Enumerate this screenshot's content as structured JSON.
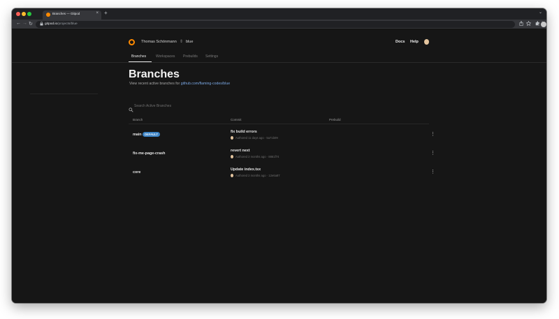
{
  "browser": {
    "tab_title": "Branches — Gitpod",
    "tab_close": "×",
    "new_tab": "+",
    "tabstrip_menu": "⌄",
    "url_host": "gitpod.io",
    "url_path": "/projects/blue",
    "nav": {
      "back": "←",
      "forward": "→",
      "reload": "↻"
    },
    "icons": {
      "lock": "lock-icon",
      "share": "share-icon",
      "star": "star-icon",
      "extensions": "puzzle-icon",
      "menu": "kebab-menu-icon"
    }
  },
  "header": {
    "owner": "Thomas Schönmann",
    "owner_switcher": "⇕",
    "project": "blue",
    "docs": "Docs",
    "help": "Help"
  },
  "subnav": {
    "tabs": [
      {
        "label": "Branches",
        "active": true
      },
      {
        "label": "Workspaces",
        "active": false
      },
      {
        "label": "Prebuilds",
        "active": false
      },
      {
        "label": "Settings",
        "active": false
      }
    ]
  },
  "main": {
    "title": "Branches",
    "subtitle_prefix": "View recent active branches for ",
    "subtitle_repo": "github.com/flaming-codes/blue",
    "search_placeholder": "Search Active Branches"
  },
  "table": {
    "headers": {
      "branch": "Branch",
      "commit": "Commit",
      "prebuild": "Prebuild"
    },
    "rows": [
      {
        "branch": "main",
        "badge": "DEFAULT",
        "commit": "fix build errors",
        "meta": "Authored 11 days ago · 5a71b09",
        "menu": "⋮"
      },
      {
        "branch": "fix-me-page-crash",
        "badge": "",
        "commit": "revert next",
        "meta": "Authored 2 months ago · 8861f74",
        "menu": "⋮"
      },
      {
        "branch": "core",
        "badge": "",
        "commit": "Update index.tsx",
        "meta": "Authored 2 months ago · 12e6a87",
        "menu": "⋮"
      }
    ]
  },
  "colors": {
    "accent": "#ff8a00",
    "link": "#7aa7e3",
    "badge": "#3b82c4",
    "background": "#161616"
  }
}
